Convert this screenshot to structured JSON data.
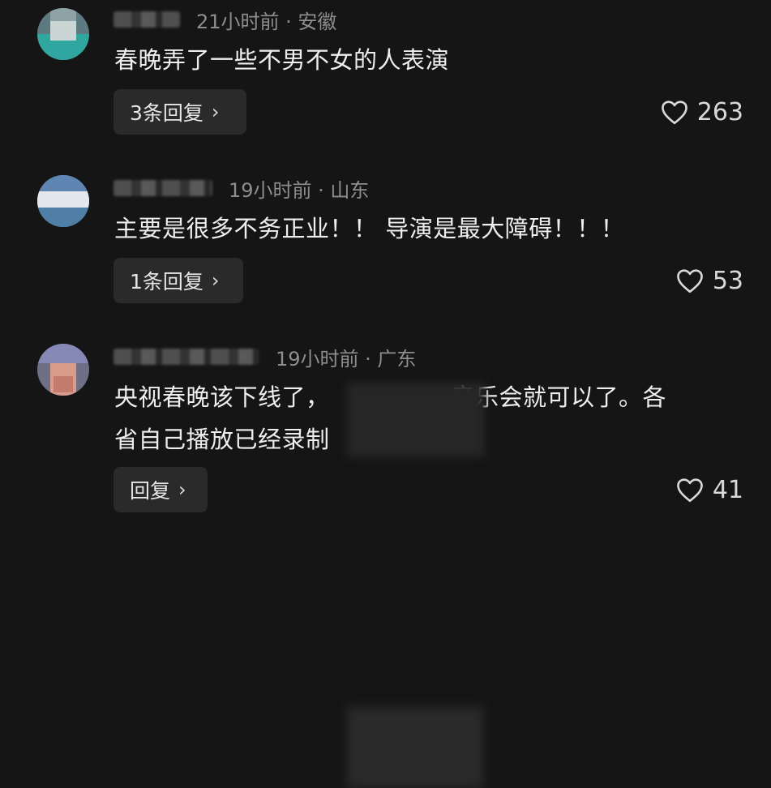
{
  "comments": [
    {
      "time": "21小时前 · 安徽",
      "text": "春晚弄了一些不男不女的人表演",
      "reply_label": "3条回复",
      "likes": "263"
    },
    {
      "time": "19小时前 · 山东",
      "text": "主要是很多不务正业！！ 导演是最大障碍！！！",
      "reply_label": "1条回复",
      "likes": "53"
    },
    {
      "time": "19小时前 · 广东",
      "text_line1_a": "央视春晚该下线了，",
      "text_line1_b": "音乐会就可以了。各",
      "text_line2": "省自己播放已经录制",
      "reply_label": "回复",
      "likes": "41"
    }
  ],
  "icons": {
    "like": "heart-outline-icon",
    "expand": "chevron-right-icon"
  },
  "colors": {
    "background": "#151515",
    "meta": "#8e8e8e",
    "button": "#2a2a2a"
  }
}
